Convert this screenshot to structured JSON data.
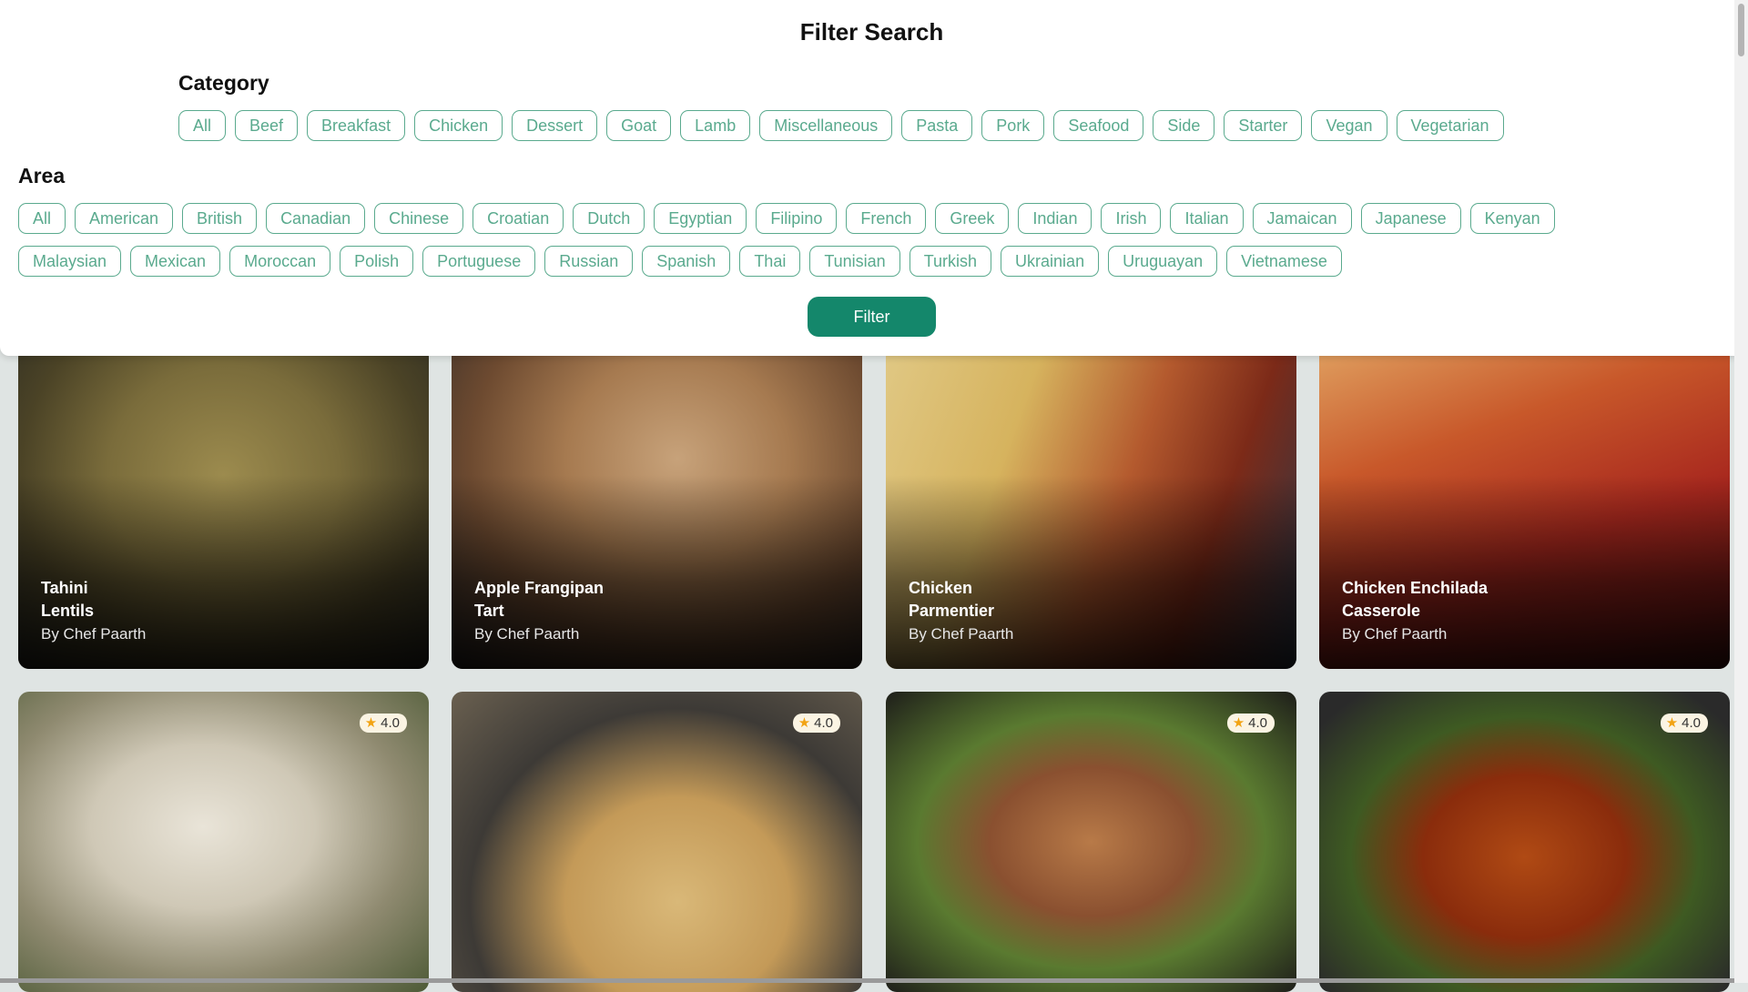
{
  "filter": {
    "title": "Filter Search",
    "category_label": "Category",
    "categories": [
      "All",
      "Beef",
      "Breakfast",
      "Chicken",
      "Dessert",
      "Goat",
      "Lamb",
      "Miscellaneous",
      "Pasta",
      "Pork",
      "Seafood",
      "Side",
      "Starter",
      "Vegan",
      "Vegetarian"
    ],
    "area_label": "Area",
    "areas_row1": [
      "All",
      "American",
      "British",
      "Canadian",
      "Chinese",
      "Croatian",
      "Dutch",
      "Egyptian",
      "Filipino",
      "French",
      "Greek",
      "Indian",
      "Irish",
      "Italian",
      "Jamaican",
      "Japanese",
      "Kenyan"
    ],
    "areas_row2": [
      "Malaysian",
      "Mexican",
      "Moroccan",
      "Polish",
      "Portuguese",
      "Russian",
      "Spanish",
      "Thai",
      "Tunisian",
      "Turkish",
      "Ukrainian",
      "Uruguayan",
      "Vietnamese"
    ],
    "button_label": "Filter",
    "accent_color": "#5aaa8e",
    "button_color": "#14876b"
  },
  "recipes_row1": [
    {
      "name_line1": "Tahini",
      "name_line2": "Lentils",
      "chef": "By Chef Paarth"
    },
    {
      "name_line1": "Apple Frangipan",
      "name_line2": "Tart",
      "chef": "By Chef Paarth"
    },
    {
      "name_line1": "Chicken",
      "name_line2": "Parmentier",
      "chef": "By Chef Paarth"
    },
    {
      "name_line1": "Chicken Enchilada",
      "name_line2": "Casserole",
      "chef": "By Chef Paarth"
    }
  ],
  "recipes_row2": [
    {
      "rating": "4.0",
      "icon": "star-icon"
    },
    {
      "rating": "4.0",
      "icon": "star-icon"
    },
    {
      "rating": "4.0",
      "icon": "star-icon"
    },
    {
      "rating": "4.0",
      "icon": "star-icon"
    }
  ]
}
